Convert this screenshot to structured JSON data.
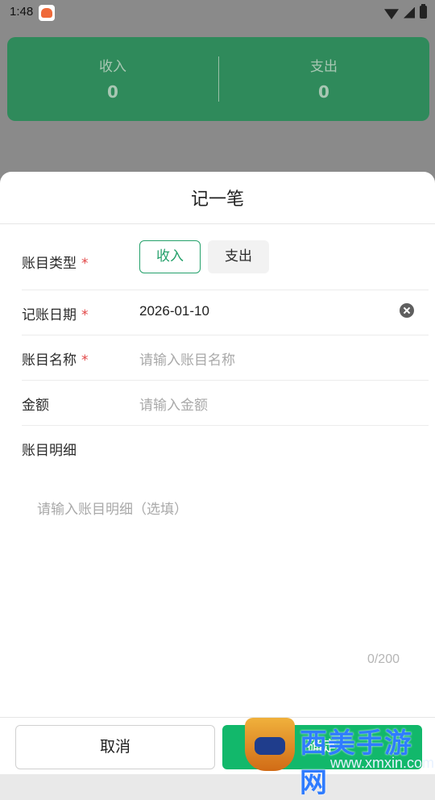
{
  "status_bar": {
    "time": "1:48"
  },
  "summary": {
    "income_label": "收入",
    "income_value": "0",
    "expense_label": "支出",
    "expense_value": "0"
  },
  "sheet": {
    "title": "记一笔",
    "fields": {
      "type": {
        "label": "账目类型",
        "required": "*",
        "options": [
          "收入",
          "支出"
        ],
        "selected": "收入"
      },
      "date": {
        "label": "记账日期",
        "required": "*",
        "value": "2026-01-10"
      },
      "name": {
        "label": "账目名称",
        "required": "*",
        "placeholder": "请输入账目名称"
      },
      "amount": {
        "label": "金额",
        "placeholder": "请输入金额"
      },
      "detail": {
        "label": "账目明细",
        "placeholder": "请输入账目明细（选填）",
        "counter": "0/200"
      }
    },
    "buttons": {
      "cancel": "取消",
      "confirm": "确定"
    }
  },
  "watermark": {
    "text": "西美手游网",
    "url": "www.xmxin.com"
  }
}
